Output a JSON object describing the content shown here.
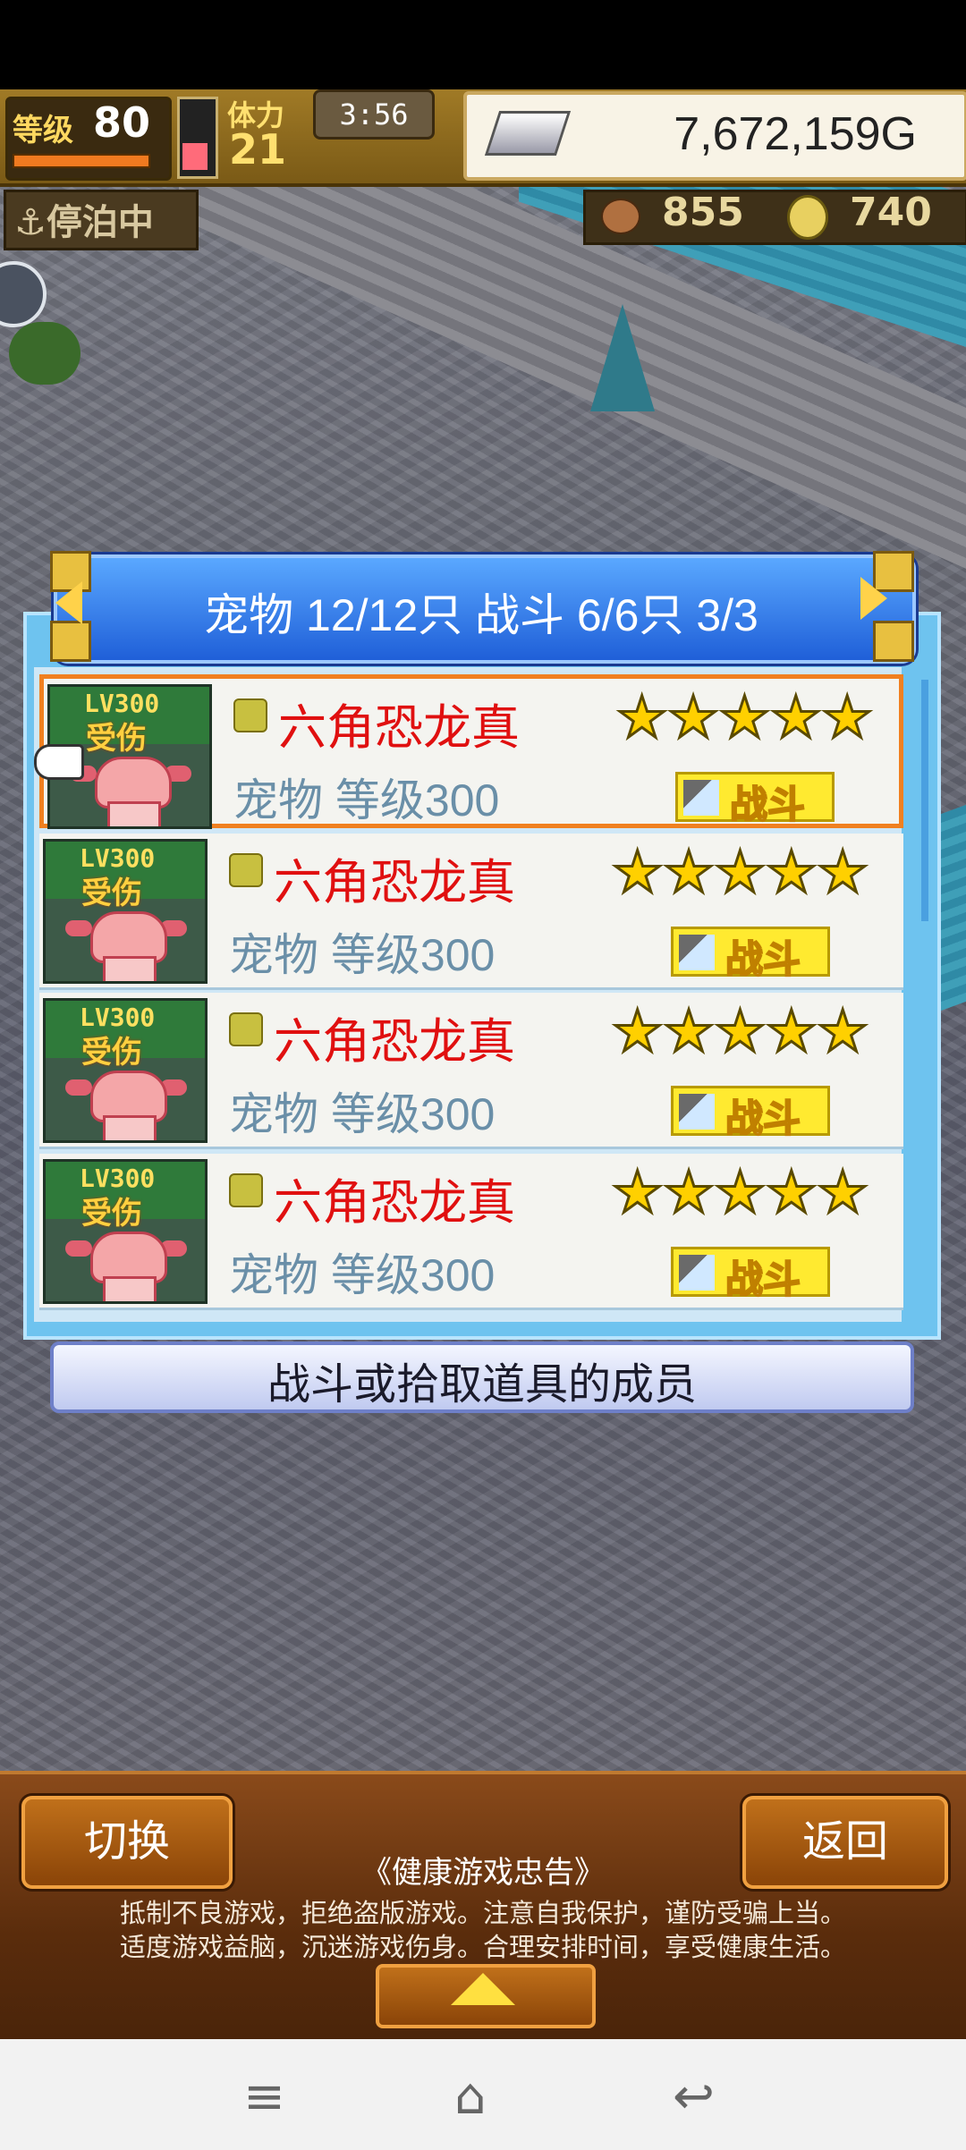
{
  "hud": {
    "level_label": "等级",
    "level_value": "80",
    "stamina_label": "体力",
    "stamina_value": "21",
    "timer": "3:56",
    "gold": "7,672,159G",
    "status": "停泊中",
    "food_value": "855",
    "medal_value": "740"
  },
  "panel": {
    "title": "宠物 12/12只 战斗 6/6只  3/3",
    "rows": [
      {
        "level_tag": "LV300",
        "status": "受伤",
        "name": "六角恐龙真",
        "info": "宠物 等级300",
        "stars": "★★★★★",
        "action": "战斗"
      },
      {
        "level_tag": "LV300",
        "status": "受伤",
        "name": "六角恐龙真",
        "info": "宠物 等级300",
        "stars": "★★★★★",
        "action": "战斗"
      },
      {
        "level_tag": "LV300",
        "status": "受伤",
        "name": "六角恐龙真",
        "info": "宠物 等级300",
        "stars": "★★★★★",
        "action": "战斗"
      },
      {
        "level_tag": "LV300",
        "status": "受伤",
        "name": "六角恐龙真",
        "info": "宠物 等级300",
        "stars": "★★★★★",
        "action": "战斗"
      }
    ],
    "hint": "战斗或拾取道具的成员"
  },
  "bottom": {
    "switch_label": "切换",
    "back_label": "返回",
    "notice_title": "《健康游戏忠告》",
    "notice_line1": "抵制不良游戏，拒绝盗版游戏。注意自我保护，谨防受骗上当。",
    "notice_line2": "适度游戏益脑，沉迷游戏伤身。合理安排时间，享受健康生活。"
  },
  "nav": {
    "menu_icon": "≡",
    "home_icon": "⌂",
    "back_icon": "↩"
  },
  "colors": {
    "accent_blue": "#1f5fd8",
    "pet_name_red": "#e01010",
    "selected_border": "#f08020",
    "battle_yellow": "#ffea30"
  }
}
